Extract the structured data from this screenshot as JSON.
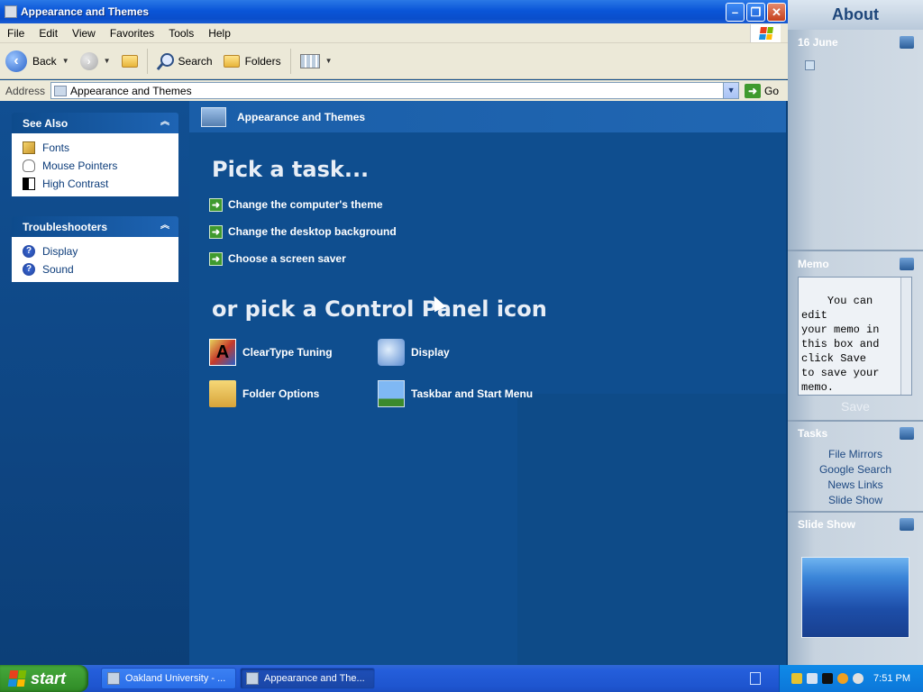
{
  "window": {
    "title": "Appearance and Themes",
    "controls": [
      "minimize",
      "restore",
      "close"
    ]
  },
  "menu": [
    "File",
    "Edit",
    "View",
    "Favorites",
    "Tools",
    "Help"
  ],
  "toolbar": {
    "back_label": "Back",
    "search_label": "Search",
    "folders_label": "Folders"
  },
  "address": {
    "label": "Address",
    "value": "Appearance and Themes",
    "go_label": "Go"
  },
  "see_also": {
    "title": "See Also",
    "items": [
      {
        "label": "Fonts",
        "icon": "fonts-folder-icon"
      },
      {
        "label": "Mouse Pointers",
        "icon": "mouse-icon"
      },
      {
        "label": "High Contrast",
        "icon": "high-contrast-icon"
      }
    ]
  },
  "troubleshooters": {
    "title": "Troubleshooters",
    "items": [
      {
        "label": "Display",
        "icon": "help-icon"
      },
      {
        "label": "Sound",
        "icon": "help-icon"
      }
    ]
  },
  "content": {
    "category_title": "Appearance and Themes",
    "pick_task": "Pick a task...",
    "tasks": [
      "Change the computer's theme",
      "Change the desktop background",
      "Choose a screen saver"
    ],
    "pick_icon": "or pick a Control Panel icon",
    "icons": [
      {
        "label": "ClearType Tuning",
        "icon": "cleartype-icon"
      },
      {
        "label": "Display",
        "icon": "display-icon"
      },
      {
        "label": "Folder Options",
        "icon": "folder-options-icon"
      },
      {
        "label": "Taskbar and Start Menu",
        "icon": "taskbar-icon"
      }
    ]
  },
  "sidebar": {
    "title": "About",
    "date": "16 June",
    "memo_title": "Memo",
    "memo_text": "You can edit\nyour memo in\nthis box and\nclick Save\nto save your\nmemo.",
    "save_label": "Save",
    "tasks_title": "Tasks",
    "task_links": [
      "File Mirrors",
      "Google Search",
      "News Links",
      "Slide Show"
    ],
    "slideshow_title": "Slide Show"
  },
  "taskbar": {
    "start_label": "start",
    "tasks": [
      {
        "label": "Oakland University - ...",
        "active": false
      },
      {
        "label": "Appearance and The...",
        "active": true
      }
    ],
    "clock": "7:51 PM"
  },
  "colors": {
    "content_bg": "#0f4e8f",
    "title_bar": "#0a55d8",
    "start_green": "#3b9a31"
  }
}
